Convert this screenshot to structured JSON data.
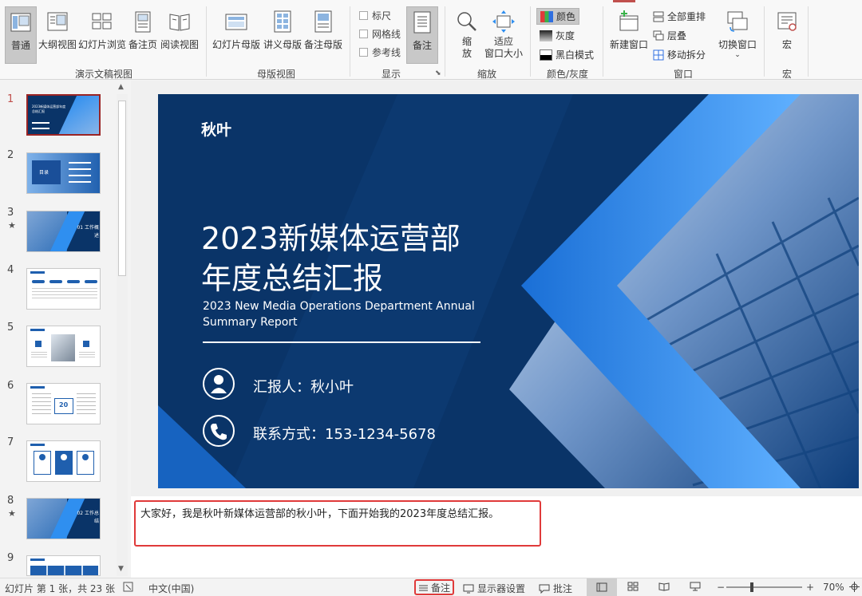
{
  "ribbon": {
    "view_group": {
      "normal": "普通",
      "outline": "大纲视图",
      "slide_sorter": "幻灯片浏览",
      "notes_page": "备注页",
      "reading_view": "阅读视图",
      "label": "演示文稿视图"
    },
    "master_group": {
      "slide_master": "幻灯片母版",
      "handout_master": "讲义母版",
      "notes_master": "备注母版",
      "label": "母版视图"
    },
    "show_group": {
      "ruler": "标尺",
      "gridlines": "网格线",
      "guides": "参考线",
      "notes": "备注",
      "label": "显示"
    },
    "zoom_group": {
      "zoom_line1": "缩",
      "zoom_line2": "放",
      "fit_line1": "适应",
      "fit_line2": "窗口大小",
      "label": "缩放"
    },
    "color_group": {
      "color": "颜色",
      "grayscale": "灰度",
      "bw": "黑白模式",
      "label": "颜色/灰度"
    },
    "window_group": {
      "new_window": "新建窗口",
      "arrange_all": "全部重排",
      "cascade": "层叠",
      "move_split": "移动拆分",
      "switch_window": "切换窗口",
      "label": "窗口"
    },
    "macro_group": {
      "macro": "宏",
      "label": "宏"
    }
  },
  "thumbnails": [
    {
      "num": "1",
      "star": "",
      "title": "2023新媒体运营部年度总结汇报"
    },
    {
      "num": "2",
      "star": "",
      "title": "目录"
    },
    {
      "num": "3",
      "star": "★",
      "title": "01 工作概述"
    },
    {
      "num": "4",
      "star": "",
      "title": ""
    },
    {
      "num": "5",
      "star": "",
      "title": ""
    },
    {
      "num": "6",
      "star": "",
      "title": "20"
    },
    {
      "num": "7",
      "star": "",
      "title": ""
    },
    {
      "num": "8",
      "star": "★",
      "title": "02 工作总结"
    },
    {
      "num": "9",
      "star": "",
      "title": ""
    }
  ],
  "slide": {
    "logo": "秋叶",
    "title_line1": "2023新媒体运营部",
    "title_line2": "年度总结汇报",
    "subtitle_line1": "2023 New Media Operations Department Annual",
    "subtitle_line2": "Summary Report",
    "reporter": "汇报人：秋小叶",
    "contact": "联系方式：153-1234-5678"
  },
  "notes": {
    "text": "大家好，我是秋叶新媒体运营部的秋小叶，下面开始我的2023年度总结汇报。"
  },
  "status": {
    "slide_info": "幻灯片 第 1 张，共 23 张",
    "language": "中文(中国)",
    "notes": "备注",
    "display_settings": "显示器设置",
    "comments": "批注",
    "zoom": "70%",
    "minus": "−",
    "plus": "+"
  },
  "colors": {
    "slide_bg": "#0a3468",
    "accent_blue": "#2f8ff0",
    "highlight_red": "#e03a3a",
    "selected_thumb": "#9b2424"
  }
}
